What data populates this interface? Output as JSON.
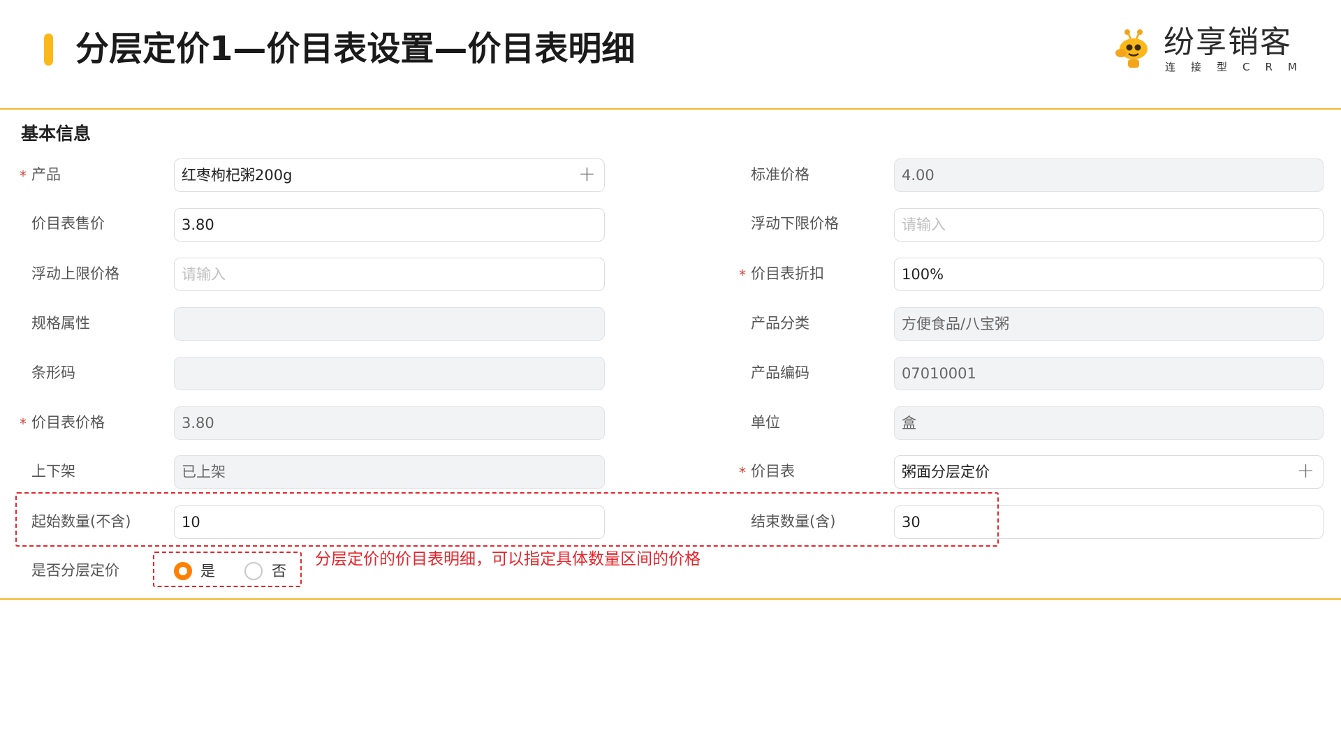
{
  "header": {
    "title": "分层定价1—价目表设置—价目表明细",
    "logo": {
      "name": "纷享销客",
      "tagline": "连接型CRM"
    }
  },
  "section": {
    "title": "基本信息"
  },
  "fields": {
    "product": {
      "label": "产品",
      "value": "红枣枸杞粥200g",
      "required": true
    },
    "standard_price": {
      "label": "标准价格",
      "value": "4.00"
    },
    "sale_price": {
      "label": "价目表售价",
      "value": "3.80"
    },
    "float_lower": {
      "label": "浮动下限价格",
      "placeholder": "请输入"
    },
    "float_upper": {
      "label": "浮动上限价格",
      "placeholder": "请输入"
    },
    "discount": {
      "label": "价目表折扣",
      "value": "100%",
      "required": true
    },
    "spec": {
      "label": "规格属性",
      "value": ""
    },
    "category": {
      "label": "产品分类",
      "value": "方便食品/八宝粥"
    },
    "barcode": {
      "label": "条形码",
      "value": ""
    },
    "product_code": {
      "label": "产品编码",
      "value": "07010001"
    },
    "pricebook_price": {
      "label": "价目表价格",
      "value": "3.80",
      "required": true
    },
    "unit": {
      "label": "单位",
      "value": "盒"
    },
    "shelf": {
      "label": "上下架",
      "value": "已上架"
    },
    "pricebook": {
      "label": "价目表",
      "value": "粥面分层定价",
      "required": true
    },
    "start_qty": {
      "label": "起始数量(不含)",
      "value": "10"
    },
    "end_qty": {
      "label": "结束数量(含)",
      "value": "30"
    },
    "tiered": {
      "label": "是否分层定价",
      "options": [
        "是",
        "否"
      ],
      "selected": "是"
    }
  },
  "required_mark": "*",
  "annotation": {
    "note": "分层定价的价目表明细，可以指定具体数量区间的价格"
  },
  "colors": {
    "accent": "#fbb818",
    "rule": "#f4b52a",
    "annotation": "#e8242a",
    "radio": "#ff8000"
  }
}
